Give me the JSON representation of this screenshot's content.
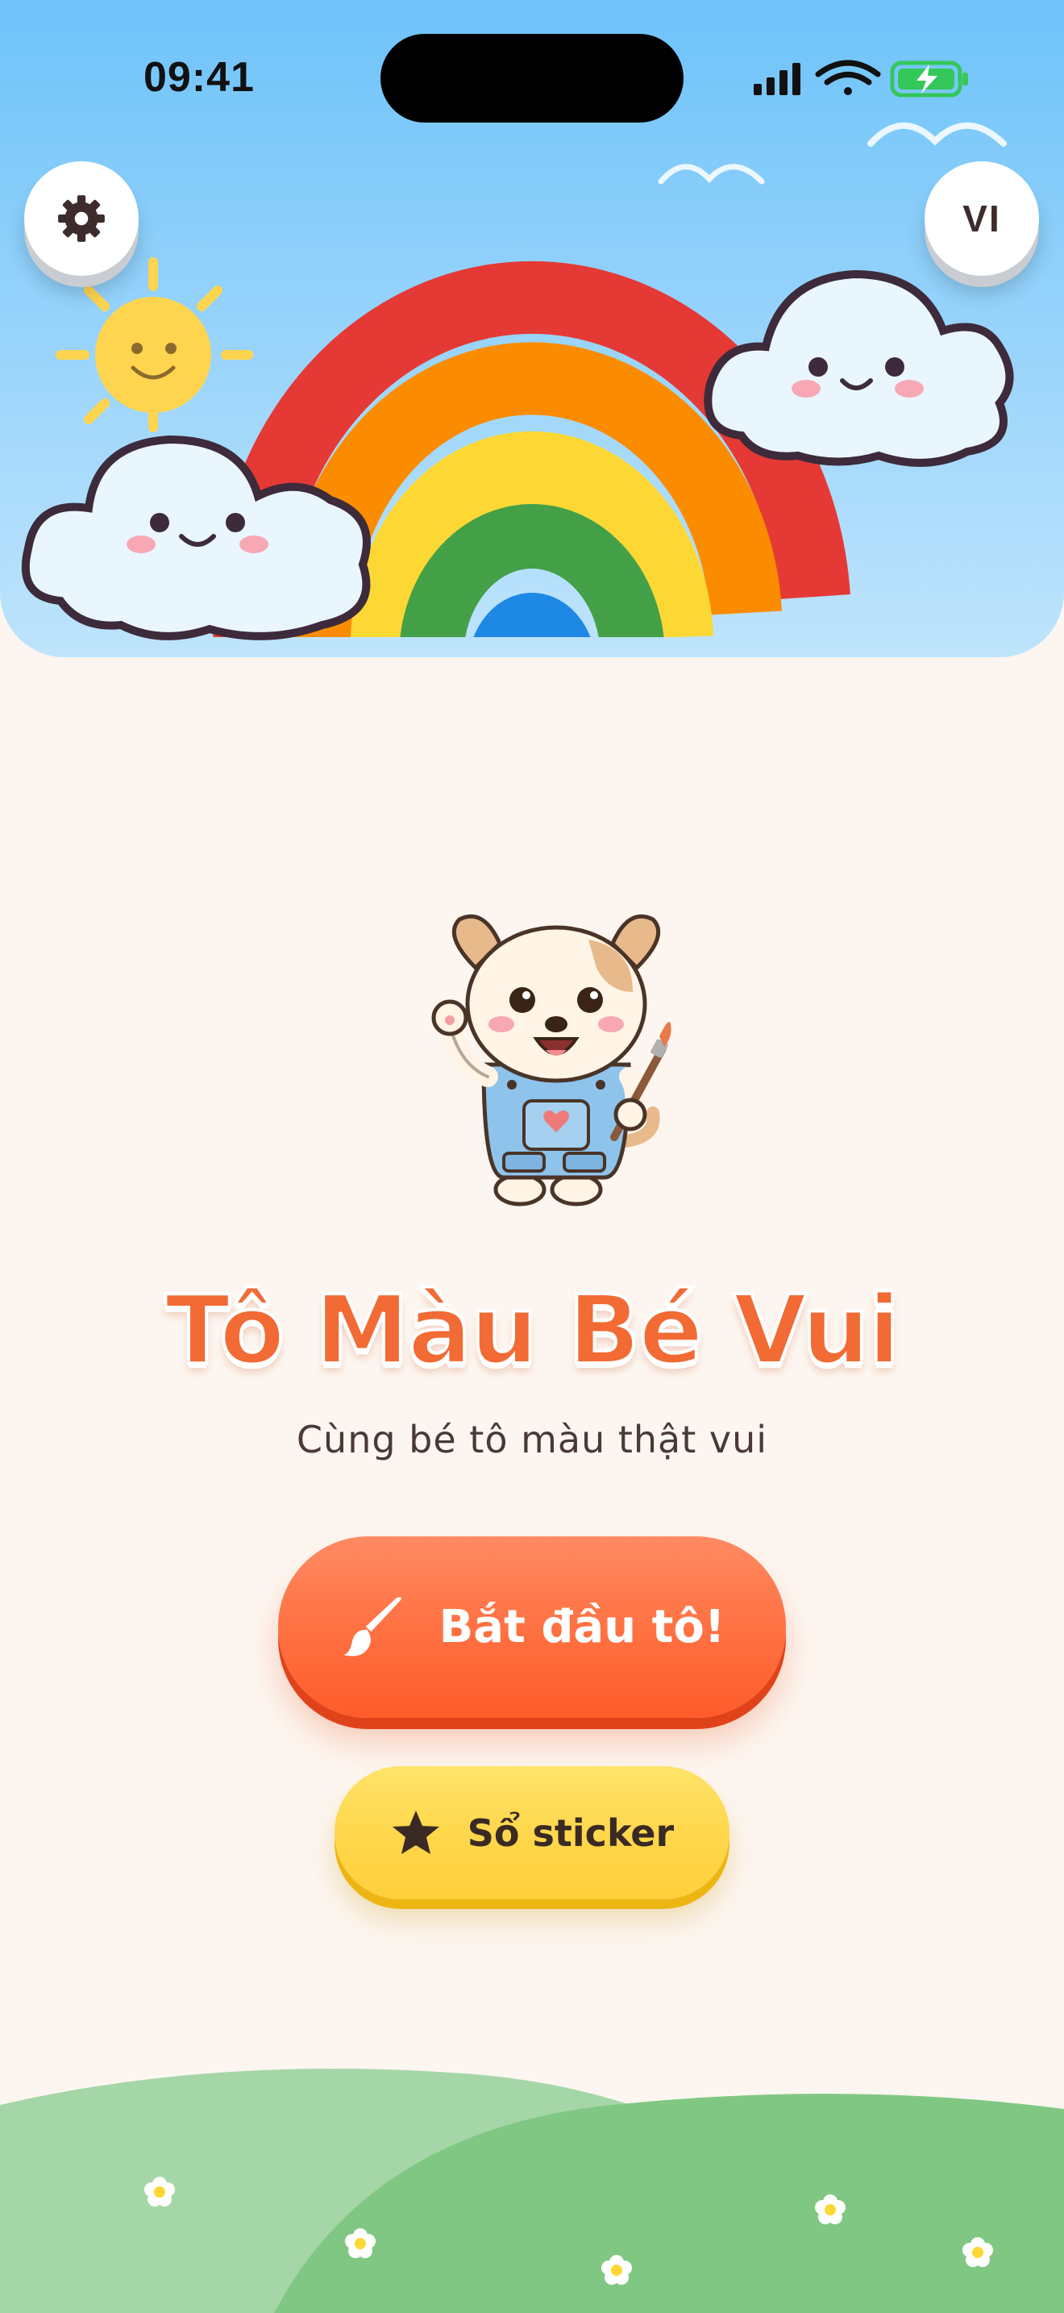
{
  "status_bar": {
    "time": "09:41"
  },
  "header": {
    "language_code": "VI",
    "settings_icon": "gear-icon"
  },
  "main": {
    "title": "Tô Màu Bé Vui",
    "subtitle": "Cùng bé tô màu thật vui"
  },
  "actions": {
    "start_label": "Bắt đầu tô!",
    "start_icon": "paintbrush-icon",
    "sticker_label": "Sổ sticker",
    "sticker_icon": "star-icon"
  },
  "colors": {
    "primary": "#FF6A3A",
    "secondary": "#FFD64A",
    "title": "#F26A34",
    "background": "#FDF6F0",
    "sky": "#8ECFFB"
  }
}
